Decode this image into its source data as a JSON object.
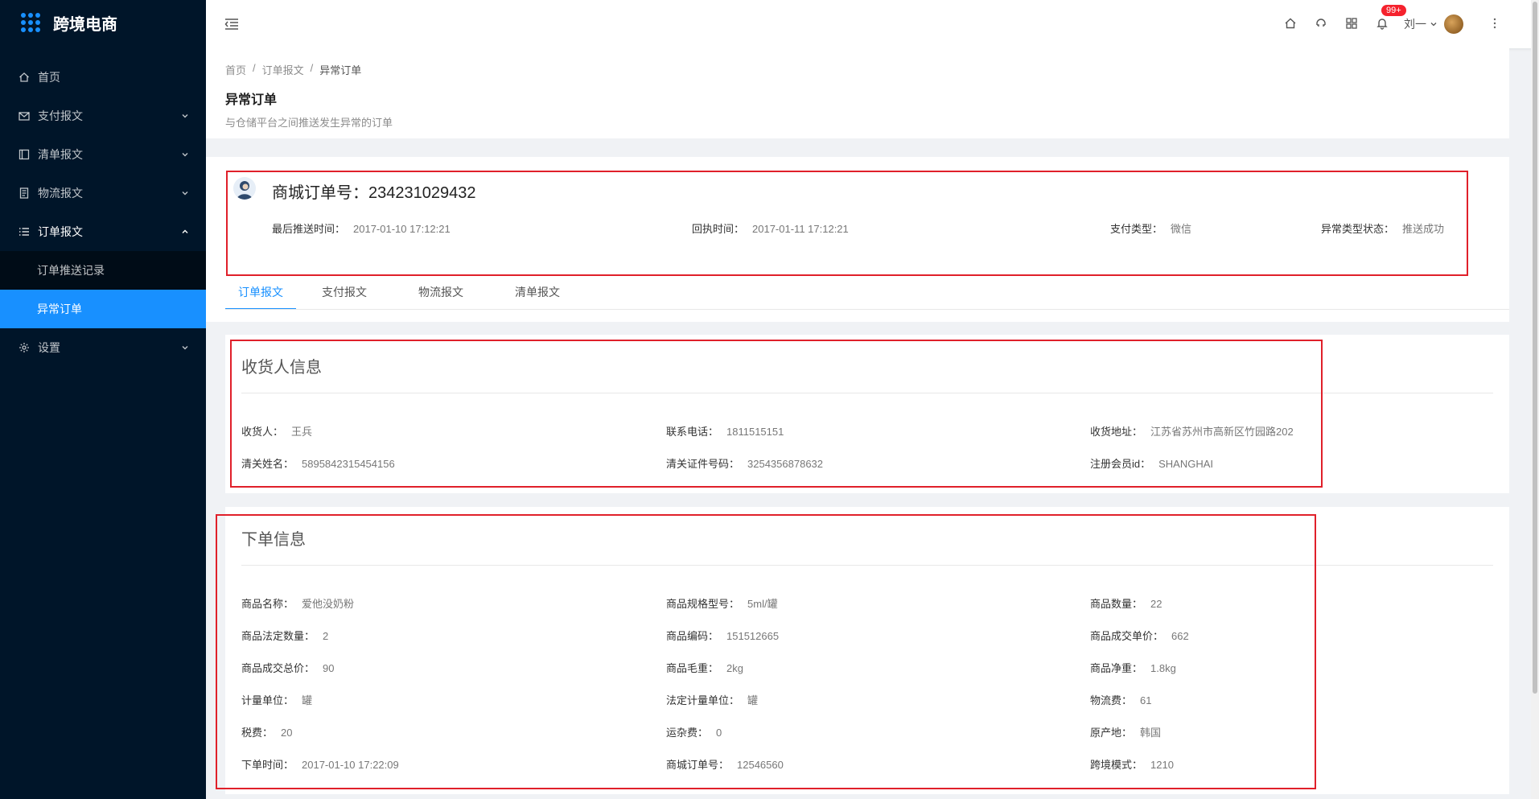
{
  "app": {
    "title": "跨境电商"
  },
  "sidebar": {
    "items": [
      {
        "label": "首页",
        "icon": "home-icon",
        "has_arrow": false
      },
      {
        "label": "支付报文",
        "icon": "mail-icon",
        "has_arrow": true
      },
      {
        "label": "清单报文",
        "icon": "list-box-icon",
        "has_arrow": true
      },
      {
        "label": "物流报文",
        "icon": "document-icon",
        "has_arrow": true
      },
      {
        "label": "订单报文",
        "icon": "list-icon",
        "has_arrow": true,
        "open": true,
        "children": [
          {
            "label": "订单推送记录",
            "active": false
          },
          {
            "label": "异常订单",
            "active": true
          }
        ]
      },
      {
        "label": "设置",
        "icon": "gear-icon",
        "has_arrow": true
      }
    ]
  },
  "header": {
    "badge": "99+",
    "user": "刘一",
    "icons": [
      "home-icon",
      "headset-icon",
      "grid-icon",
      "bell-icon",
      "more-vertical-icon"
    ]
  },
  "page": {
    "breadcrumb": [
      "首页",
      "订单报文",
      "异常订单"
    ],
    "title": "异常订单",
    "desc": "与仓储平台之间推送发生异常的订单"
  },
  "order": {
    "number_label": "商城订单号：",
    "number": "234231029432",
    "meta": [
      {
        "k": "最后推送时间：",
        "v": "2017-01-10 17:12:21"
      },
      {
        "k": "回执时间：",
        "v": "2017-01-11 17:12:21"
      },
      {
        "k": "支付类型：",
        "v": "微信"
      },
      {
        "k": "异常类型状态：",
        "v": "推送成功"
      }
    ],
    "tabs": [
      "订单报文",
      "支付报文",
      "物流报文",
      "清单报文"
    ]
  },
  "consignee": {
    "title": "收货人信息",
    "fields": [
      {
        "k": "收货人：",
        "v": "王兵"
      },
      {
        "k": "联系电话：",
        "v": "1811515151"
      },
      {
        "k": "收货地址：",
        "v": "江苏省苏州市高新区竹园路202"
      },
      {
        "k": "清关姓名：",
        "v": "5895842315454156"
      },
      {
        "k": "清关证件号码：",
        "v": "3254356878632"
      },
      {
        "k": "注册会员id：",
        "v": "SHANGHAI"
      }
    ]
  },
  "orderinfo": {
    "title": "下单信息",
    "fields": [
      {
        "k": "商品名称：",
        "v": "爱他没奶粉"
      },
      {
        "k": "商品规格型号：",
        "v": "5ml/罐"
      },
      {
        "k": "商品数量：",
        "v": "22"
      },
      {
        "k": "商品法定数量：",
        "v": "2"
      },
      {
        "k": "商品编码：",
        "v": "151512665"
      },
      {
        "k": "商品成交单价：",
        "v": "662"
      },
      {
        "k": "商品成交总价：",
        "v": "90"
      },
      {
        "k": "商品毛重：",
        "v": "2kg"
      },
      {
        "k": "商品净重：",
        "v": "1.8kg"
      },
      {
        "k": "计量单位：",
        "v": "罐"
      },
      {
        "k": "法定计量单位：",
        "v": "罐"
      },
      {
        "k": "物流费：",
        "v": "61"
      },
      {
        "k": "税费：",
        "v": "20"
      },
      {
        "k": "运杂费：",
        "v": "0"
      },
      {
        "k": "原产地：",
        "v": "韩国"
      },
      {
        "k": "下单时间：",
        "v": "2017-01-10 17:22:09"
      },
      {
        "k": "商城订单号：",
        "v": "12546560"
      },
      {
        "k": "跨境模式：",
        "v": "1210"
      }
    ]
  }
}
